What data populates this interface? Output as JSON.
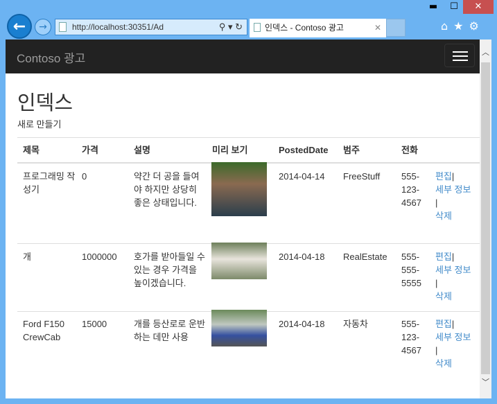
{
  "browser": {
    "url": "http://localhost:30351/Ad",
    "tab_title": "인덱스 - Contoso 광고",
    "window_controls": [
      "minimize-icon",
      "maximize-icon",
      "close-icon"
    ],
    "tool_icons": [
      "home-icon",
      "favorites-star-icon",
      "gear-icon"
    ]
  },
  "navbar": {
    "brand": "Contoso 광고"
  },
  "page": {
    "title": "인덱스",
    "create_link": "새로 만들기"
  },
  "table": {
    "headers": [
      "제목",
      "가격",
      "설명",
      "미리 보기",
      "PostedDate",
      "범주",
      "전화"
    ],
    "rows": [
      {
        "title": "프로그래밍 작성기",
        "price": "0",
        "description": "약간 더 공을 들여야 하지만 상당히 좋은 상태입니다.",
        "image": "man-portrait-photo",
        "date": "2014-04-14",
        "category": "FreeStuff",
        "phone": "555-123-4567"
      },
      {
        "title": "개",
        "price": "1000000",
        "description": "호가를 받아들일 수 있는 경우 가격을 높이겠습니다.",
        "image": "white-dog-photo",
        "date": "2014-04-18",
        "category": "RealEstate",
        "phone": "555-555-5555"
      },
      {
        "title": "Ford F150 CrewCab",
        "price": "15000",
        "description": "개를 등산로로 운반하는 데만 사용",
        "image": "truck-group-photo",
        "date": "2014-04-18",
        "category": "자동차",
        "phone": "555-123-4567"
      }
    ],
    "actions": {
      "edit": "편집",
      "details": "세부 정보",
      "delete": "삭제",
      "sep": "|"
    }
  },
  "colors": {
    "link": "#428bca",
    "navbar": "#222222",
    "close_button": "#c75050"
  }
}
